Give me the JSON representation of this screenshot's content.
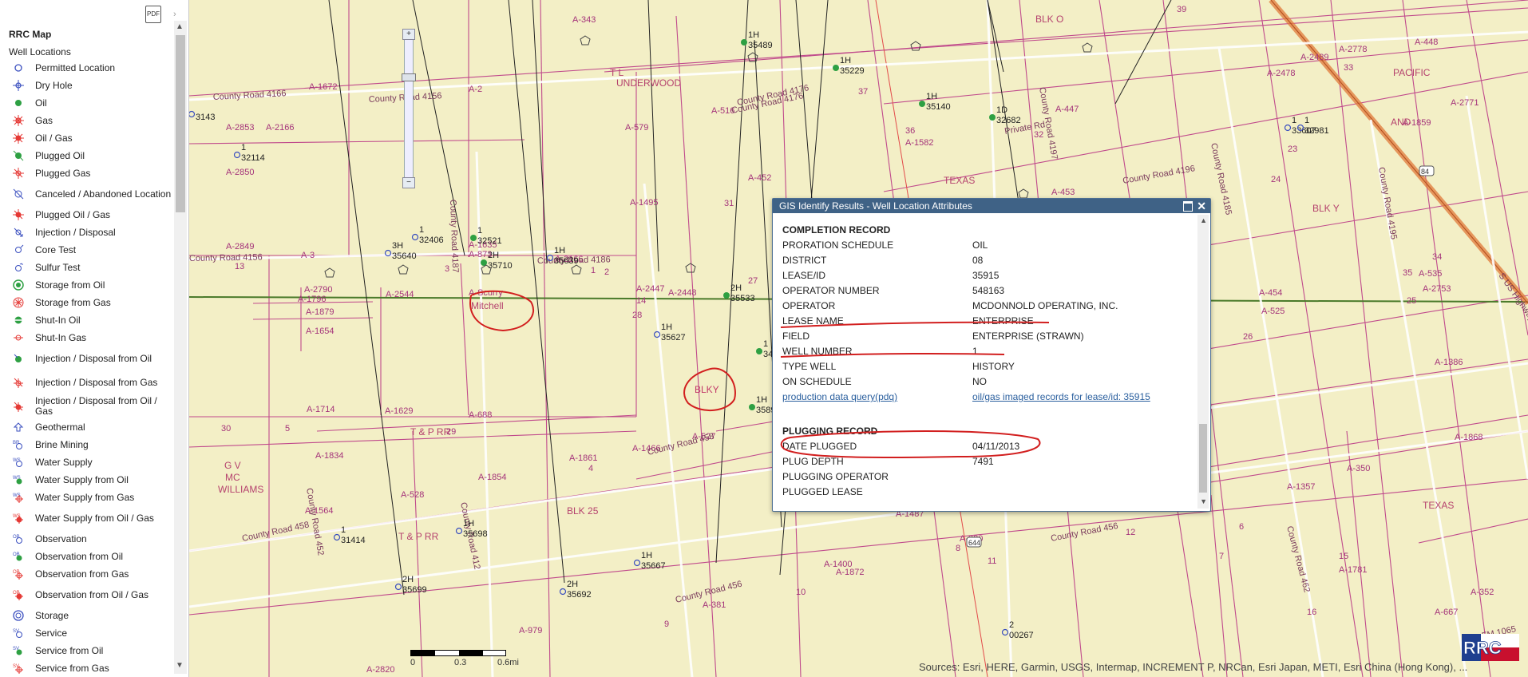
{
  "sidebar": {
    "pdf_icon": "PDF",
    "collapse": "›",
    "title": "RRC Map",
    "subtitle": "Well Locations",
    "items": [
      {
        "label": "Permitted Location",
        "icon": "circle-open"
      },
      {
        "label": "Dry Hole",
        "icon": "dry-hole"
      },
      {
        "label": "Oil",
        "icon": "dot-green"
      },
      {
        "label": "Gas",
        "icon": "gas-star"
      },
      {
        "label": "Oil / Gas",
        "icon": "oil-gas-star"
      },
      {
        "label": "Plugged Oil",
        "icon": "plugged-oil"
      },
      {
        "label": "Plugged Gas",
        "icon": "plugged-gas"
      },
      {
        "label": "Canceled / Abandoned Location",
        "icon": "canceled"
      },
      {
        "label": "Plugged Oil / Gas",
        "icon": "plugged-oil-gas"
      },
      {
        "label": "Injection / Disposal",
        "icon": "injection"
      },
      {
        "label": "Core Test",
        "icon": "core-test"
      },
      {
        "label": "Sulfur Test",
        "icon": "sulfur-test"
      },
      {
        "label": "Storage from Oil",
        "icon": "storage-oil"
      },
      {
        "label": "Storage from Gas",
        "icon": "storage-gas"
      },
      {
        "label": "Shut-In Oil",
        "icon": "shut-in-oil"
      },
      {
        "label": "Shut-In Gas",
        "icon": "shut-in-gas"
      },
      {
        "label": "Injection / Disposal from Oil",
        "icon": "inj-oil"
      },
      {
        "label": "Injection / Disposal from Gas",
        "icon": "inj-gas"
      },
      {
        "label": "Injection / Disposal from Oil / Gas",
        "icon": "inj-oil-gas"
      },
      {
        "label": "Geothermal",
        "icon": "geothermal"
      },
      {
        "label": "Brine Mining",
        "icon": "brine"
      },
      {
        "label": "Water Supply",
        "icon": "water"
      },
      {
        "label": "Water Supply from Oil",
        "icon": "water-oil"
      },
      {
        "label": "Water Supply from Gas",
        "icon": "water-gas"
      },
      {
        "label": "Water Supply from Oil / Gas",
        "icon": "water-oil-gas"
      },
      {
        "label": "Observation",
        "icon": "obs"
      },
      {
        "label": "Observation from Oil",
        "icon": "obs-oil"
      },
      {
        "label": "Observation from Gas",
        "icon": "obs-gas"
      },
      {
        "label": "Observation from Oil / Gas",
        "icon": "obs-oil-gas"
      },
      {
        "label": "Storage",
        "icon": "storage"
      },
      {
        "label": "Service",
        "icon": "service"
      },
      {
        "label": "Service from Oil",
        "icon": "service-oil"
      },
      {
        "label": "Service from Gas",
        "icon": "service-gas"
      }
    ]
  },
  "zoom": {
    "plus": "+",
    "minus": "−"
  },
  "scale": {
    "labels": [
      "0",
      "0.3",
      "0.6mi"
    ]
  },
  "attribution": "Sources: Esri, HERE, Garmin, USGS, Intermap, INCREMENT P, NRCan, Esri Japan, METI, Esri China (Hong Kong), ...",
  "logo_text": "RRC",
  "popup": {
    "title": "GIS Identify Results - Well Location Attributes",
    "completion_title": "COMPLETION RECORD",
    "completion": [
      {
        "key": "PRORATION SCHEDULE",
        "value": "OIL"
      },
      {
        "key": "DISTRICT",
        "value": "08"
      },
      {
        "key": "LEASE/ID",
        "value": "35915"
      },
      {
        "key": "OPERATOR NUMBER",
        "value": "548163"
      },
      {
        "key": "OPERATOR",
        "value": "MCDONNOLD OPERATING, INC."
      },
      {
        "key": "LEASE NAME",
        "value": "ENTERPRISE"
      },
      {
        "key": "FIELD",
        "value": "ENTERPRISE (STRAWN)"
      },
      {
        "key": "WELL NUMBER",
        "value": "1"
      },
      {
        "key": "TYPE WELL",
        "value": "HISTORY"
      },
      {
        "key": "ON SCHEDULE",
        "value": "NO"
      }
    ],
    "link_left": "production data query(pdq)",
    "link_right": "oil/gas imaged records for lease/id: 35915",
    "plugging_title": "PLUGGING RECORD",
    "plugging": [
      {
        "key": "DATE PLUGGED",
        "value": "04/11/2013"
      },
      {
        "key": "PLUG DEPTH",
        "value": "7491"
      },
      {
        "key": "PLUGGING OPERATOR",
        "value": ""
      },
      {
        "key": "PLUGGED LEASE",
        "value": ""
      }
    ]
  },
  "map": {
    "abstract_labels": [
      "A-343",
      "A-1672",
      "A-2",
      "A-2853",
      "A-2166",
      "A-2850",
      "A-1635",
      "A-873",
      "A-2166",
      "A-2849",
      "A-3",
      "A-2790",
      "A-1796",
      "A-1879",
      "A-1654",
      "A-2544",
      "A-Scurry",
      "A-1714",
      "A-1629",
      "A-688",
      "A-2447",
      "A-2448",
      "A-579",
      "A-516",
      "A-452",
      "A-1495",
      "A-1582",
      "A-447",
      "A-453",
      "A-2478",
      "A-2489",
      "A-2778",
      "A-448",
      "A-1859",
      "A-2771",
      "A-535",
      "A-2753",
      "A-454",
      "A-525",
      "A-1386",
      "A-1868",
      "A-350",
      "A-1357",
      "A-1781",
      "A-667",
      "A-352",
      "A-1466",
      "A-1861",
      "A-1854",
      "A-528",
      "A-1564",
      "A-1834",
      "A-527",
      "A-1400",
      "A-1872",
      "A-1487",
      "A-380",
      "A-381",
      "A-979",
      "A-2820"
    ],
    "road_labels": [
      "County Road 4166",
      "County Road 4156",
      "County Road 4156",
      "County Road 4186",
      "County Road 4176",
      "County Road 4176",
      "Private Rd",
      "County Road 4197",
      "County Road 4196",
      "County Road 4185",
      "County Road 4195",
      "County Road 458",
      "County Road 458",
      "County Road 456",
      "County Road 456",
      "County Road 462",
      "County Road 412",
      "County Road 4187",
      "County Road 452",
      "County Road 456",
      "S US Highway",
      "FM 1065"
    ],
    "place_labels": [
      "UNDERWOOD",
      "T L",
      "BLK O",
      "TEXAS",
      "AND",
      "PACIFIC",
      "BLK Y",
      "T & P RR",
      "T & P RR",
      "BLK 25",
      "G V",
      "MC",
      "WILLIAMS",
      "TEXAS",
      "BLKY",
      "Mitchell"
    ],
    "section_numbers": [
      "39",
      "33",
      "37",
      "36",
      "31",
      "27",
      "28",
      "32",
      "24",
      "23",
      "25",
      "26",
      "29",
      "30",
      "34",
      "35",
      "1",
      "2",
      "3",
      "4",
      "5",
      "6",
      "7",
      "8",
      "9",
      "10",
      "11",
      "12",
      "13",
      "14",
      "15",
      "16"
    ],
    "wells": [
      {
        "id": "35489",
        "num": "1H"
      },
      {
        "id": "35229",
        "num": "1H"
      },
      {
        "id": "35140",
        "num": "1H"
      },
      {
        "id": "32682",
        "num": "1D"
      },
      {
        "id": "32981",
        "num": "1"
      },
      {
        "id": "33607",
        "num": "1"
      },
      {
        "id": "32114",
        "num": "1"
      },
      {
        "id": "32406",
        "num": "1"
      },
      {
        "id": "35640",
        "num": "3H"
      },
      {
        "id": "32521",
        "num": "1"
      },
      {
        "id": "35710",
        "num": "2H"
      },
      {
        "id": "35639",
        "num": "1H"
      },
      {
        "id": "35533",
        "num": "2H"
      },
      {
        "id": "35627",
        "num": "1H"
      },
      {
        "id": "35698",
        "num": "1H"
      },
      {
        "id": "35667",
        "num": "1H"
      },
      {
        "id": "35692",
        "num": "2H"
      },
      {
        "id": "35699",
        "num": "2H"
      },
      {
        "id": "31414",
        "num": "1"
      },
      {
        "id": "00267",
        "num": "2"
      },
      {
        "id": "3143",
        "num": ""
      },
      {
        "id": "3589",
        "num": "1H"
      },
      {
        "id": "34",
        "num": "1"
      }
    ],
    "highway_shields": [
      "84",
      "644"
    ],
    "annotation_labels": [
      "BLKY"
    ]
  }
}
